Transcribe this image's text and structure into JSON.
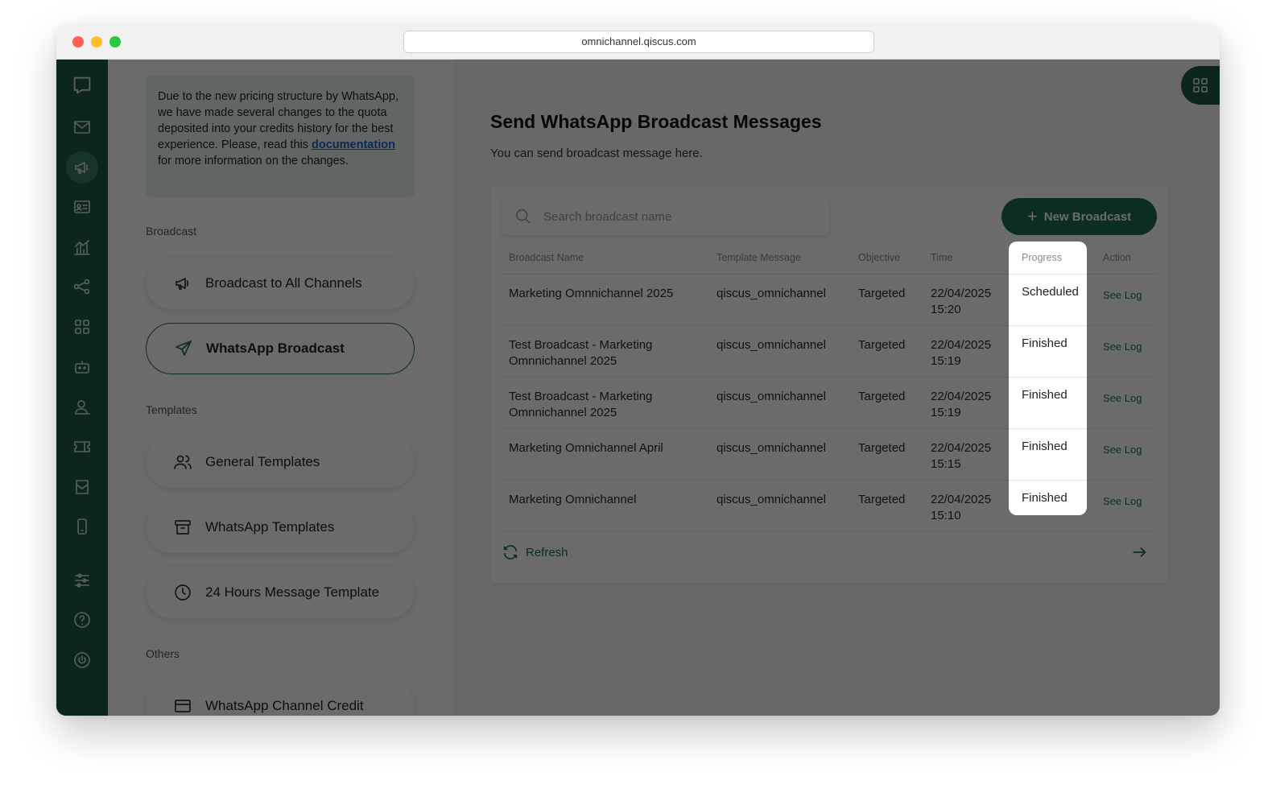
{
  "browser": {
    "url": "omnichannel.qiscus.com"
  },
  "rail": {
    "icons": [
      "chat-logo-icon",
      "mail-icon",
      "megaphone-icon",
      "contact-card-icon",
      "chart-icon",
      "share-nodes-icon",
      "apps-grid-icon",
      "bot-icon",
      "agent-icon",
      "ticket-icon",
      "inbox-icon",
      "mobile-icon",
      "settings-sliders-icon",
      "help-icon",
      "power-icon"
    ],
    "active": "megaphone-icon"
  },
  "notice": {
    "text_before": "Due to the new pricing structure by WhatsApp, we have made several changes to the quota deposited into your credits history for the best experience. Please, read this ",
    "link": "documentation",
    "text_after": " for more information on the changes."
  },
  "sections": {
    "broadcast": "Broadcast",
    "templates": "Templates",
    "others": "Others"
  },
  "nav": {
    "broadcast_all": "Broadcast to All Channels",
    "whatsapp_broadcast": "WhatsApp Broadcast",
    "general_templates": "General Templates",
    "whatsapp_templates": "WhatsApp Templates",
    "hours_template": "24 Hours Message Template",
    "channel_credit": "WhatsApp Channel Credit"
  },
  "main": {
    "title": "Send WhatsApp Broadcast Messages",
    "subtitle": "You can send broadcast message here.",
    "search_placeholder": "Search broadcast name",
    "new_button": "New Broadcast",
    "refresh": "Refresh"
  },
  "table": {
    "headers": [
      "Broadcast Name",
      "Template Message",
      "Objective",
      "Time",
      "Progress",
      "Action"
    ],
    "rows": [
      {
        "name": "Marketing Omnnichannel 2025",
        "template": "qiscus_omnichannel",
        "objective": "Targeted",
        "date": "22/04/2025",
        "time": "15:20",
        "progress": "Scheduled",
        "action": "See Log"
      },
      {
        "name": "Test Broadcast - Marketing Omnnichannel 2025",
        "template": "qiscus_omnichannel",
        "objective": "Targeted",
        "date": "22/04/2025",
        "time": "15:19",
        "progress": "Finished",
        "action": "See Log"
      },
      {
        "name": "Test Broadcast - Marketing Omnnichannel 2025",
        "template": "qiscus_omnichannel",
        "objective": "Targeted",
        "date": "22/04/2025",
        "time": "15:19",
        "progress": "Finished",
        "action": "See Log"
      },
      {
        "name": "Marketing Omnichannel April",
        "template": "qiscus_omnichannel",
        "objective": "Targeted",
        "date": "22/04/2025",
        "time": "15:15",
        "progress": "Finished",
        "action": "See Log"
      },
      {
        "name": "Marketing Omnichannel",
        "template": "qiscus_omnichannel",
        "objective": "Targeted",
        "date": "22/04/2025",
        "time": "15:10",
        "progress": "Finished",
        "action": "See Log"
      }
    ]
  },
  "colors": {
    "brand": "#1e6b52",
    "rail": "#1e5a47",
    "link": "#1a5fd1"
  }
}
